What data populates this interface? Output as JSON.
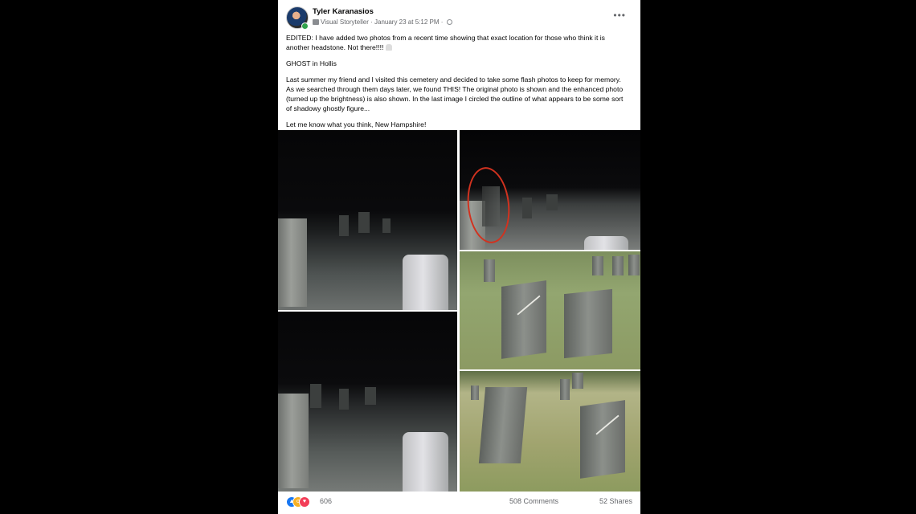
{
  "post": {
    "author": "Tyler Karanasios",
    "badge": "Visual Storyteller",
    "timestamp": "January 23 at 5:12 PM",
    "more_icon": "more-horizontal-icon",
    "paragraphs": [
      "EDITED: I have added two photos from a recent time showing that exact location for those who think it is another headstone. Not there!!!!",
      "GHOST in Hollis",
      "Last summer my friend and I visited this cemetery and decided to take some flash photos to keep for memory. As we searched through them days later, we found THIS! The original photo is shown and the enhanced photo (turned up the brightness) is also shown. In the last image I circled the outline of what appears to be some sort of shadowy ghostly figure...",
      "Let me know what you think, New Hampshire!"
    ]
  },
  "footer": {
    "reaction_icons": [
      "like-icon",
      "wow-icon",
      "love-icon"
    ],
    "reaction_count": "606",
    "comments": "508 Comments",
    "shares": "52 Shares"
  },
  "colors": {
    "background": "#000000",
    "card": "#ffffff",
    "secondary_text": "#65676b",
    "like": "#1877f2",
    "love": "#f33e58",
    "wow": "#f7b125",
    "online": "#31a24c",
    "circle_annotation": "#d1321f"
  }
}
